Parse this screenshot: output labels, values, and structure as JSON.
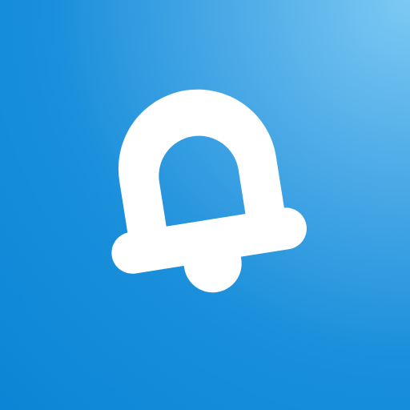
{
  "app_icon": {
    "icon": "bell-icon",
    "colors": {
      "background_light": "#7cc9f3",
      "background_mid": "#1a8fdb",
      "background_dark": "#0a86d6",
      "glyph": "#ffffff"
    }
  }
}
